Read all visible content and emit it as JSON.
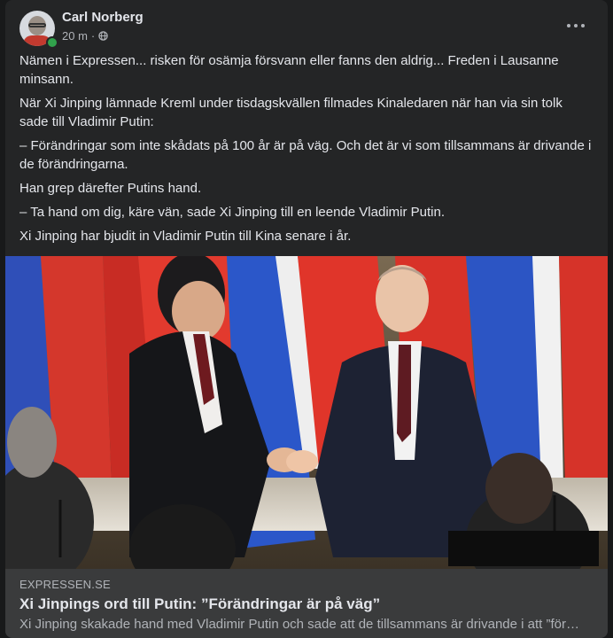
{
  "post": {
    "author": "Carl Norberg",
    "time": "20 m",
    "separator": "·",
    "paragraphs": [
      "Nämen i Expressen... risken för osämja försvann eller fanns den aldrig... Freden i Lausanne minsann.",
      "När Xi Jinping lämnade Kreml under tisdagskvällen filmades Kinaledaren när han via sin tolk sade till Vladimir Putin:",
      "– Förändringar som inte skådats på 100 år är på väg. Och det är vi som tillsammans är drivande i de förändringarna.",
      "Han grep därefter Putins hand.",
      "– Ta hand om dig, käre vän, sade Xi Jinping till en leende Vladimir Putin.",
      "Xi Jinping har bjudit in Vladimir Putin till Kina senare i år."
    ]
  },
  "link": {
    "domain": "EXPRESSEN.SE",
    "title": "Xi Jinpings ord till Putin: ”Förändringar är på väg”",
    "description": "Xi Jinping skakade hand med Vladimir Putin och sade att de tillsammans är drivande i att ”för…"
  },
  "icons": {
    "audience": "globe-icon",
    "more": "more-options-icon",
    "presence": "online-status-icon"
  },
  "colors": {
    "card_bg": "#242526",
    "link_bg": "#3a3b3c",
    "text_primary": "#e4e6eb",
    "text_secondary": "#b0b3b8",
    "online": "#31a24c"
  }
}
